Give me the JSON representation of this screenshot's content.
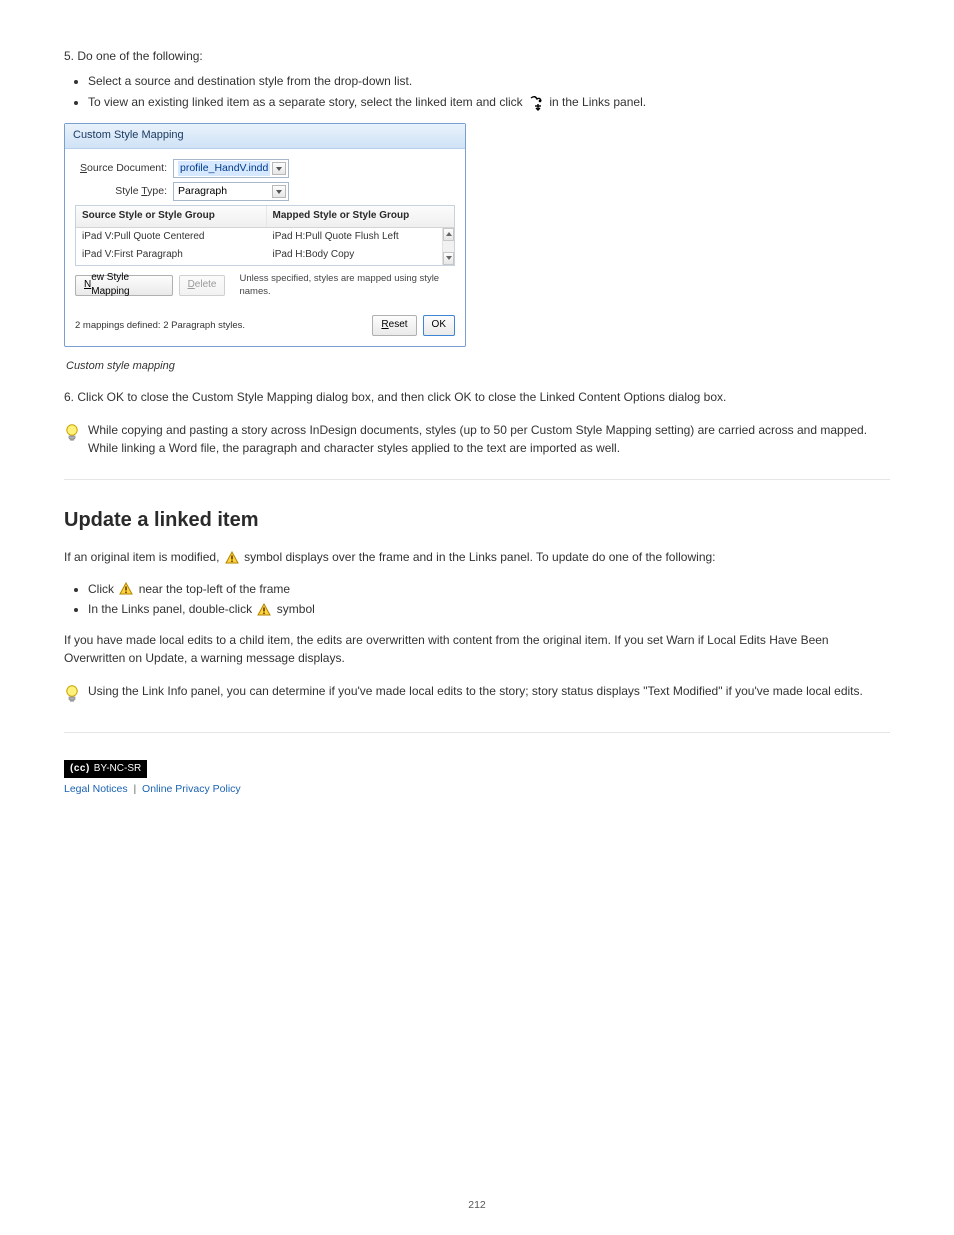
{
  "intro": "5. Do one of the following:",
  "bullets_top": [
    "Select a source and destination style from the drop-down list.",
    "To view an existing linked item as a separate story, select the linked item and click"
  ],
  "bullet_b_tail": "in the Links panel.",
  "dialog": {
    "title": "Custom Style Mapping",
    "source_label": "Source Document:",
    "source_ul": "S",
    "source_value": "profile_HandV.indd",
    "type_label": "Style Type:",
    "type_ul": "T",
    "type_value": "Paragraph",
    "col1": "Source Style or Style Group",
    "col2": "Mapped Style or Style Group",
    "rows": [
      {
        "src": "iPad V:Pull Quote Centered",
        "dst": "iPad H:Pull Quote Flush Left"
      },
      {
        "src": "iPad V:First Paragraph",
        "dst": "iPad H:Body Copy"
      }
    ],
    "new_btn": "New Style Mapping",
    "new_ul": "N",
    "delete_btn": "Delete",
    "delete_ul": "D",
    "hint": "Unless specified, styles are mapped using style names.",
    "status": "2 mappings defined:  2 Paragraph styles.",
    "reset_btn": "Reset",
    "reset_ul": "R",
    "ok_btn": "OK"
  },
  "caption": "Custom style mapping",
  "step6": "6. Click OK to close the Custom Style Mapping dialog box, and then click OK to close the Linked Content Options dialog box.",
  "tip1_a": "While copying and pasting a story across InDesign documents, styles (up to 50 per Custom Style Mapping setting) are carried across and mapped. While linking a Word file, the ",
  "tip1_b": "paragraph and character styles applied to the text are imported as well.",
  "update_heading": "Update a linked item",
  "update_p1_a": "If an original item is modified, ",
  "update_p1_b": " symbol displays over the frame and in the Links panel. To update do one of the following:",
  "update_bullets": [
    {
      "pre": "Click ",
      "post": " near the top-left of the frame"
    },
    {
      "pre": "In the Links panel, double-click ",
      "post": " symbol"
    }
  ],
  "update_p2": "If you have made local edits to a child item, the edits are overwritten with content from the original item. If you set Warn if Local Edits Have Been Overwritten on Update, a warning message displays.",
  "tip2": "Using the Link Info panel, you can determine if you've made local edits to the story; story status displays \"Text Modified\" if you've made local edits.",
  "cc_text": "(cc)",
  "cc_label": "BY-NC-SR",
  "legal": "Legal Notices | Online Privacy Policy",
  "page_number": "212"
}
